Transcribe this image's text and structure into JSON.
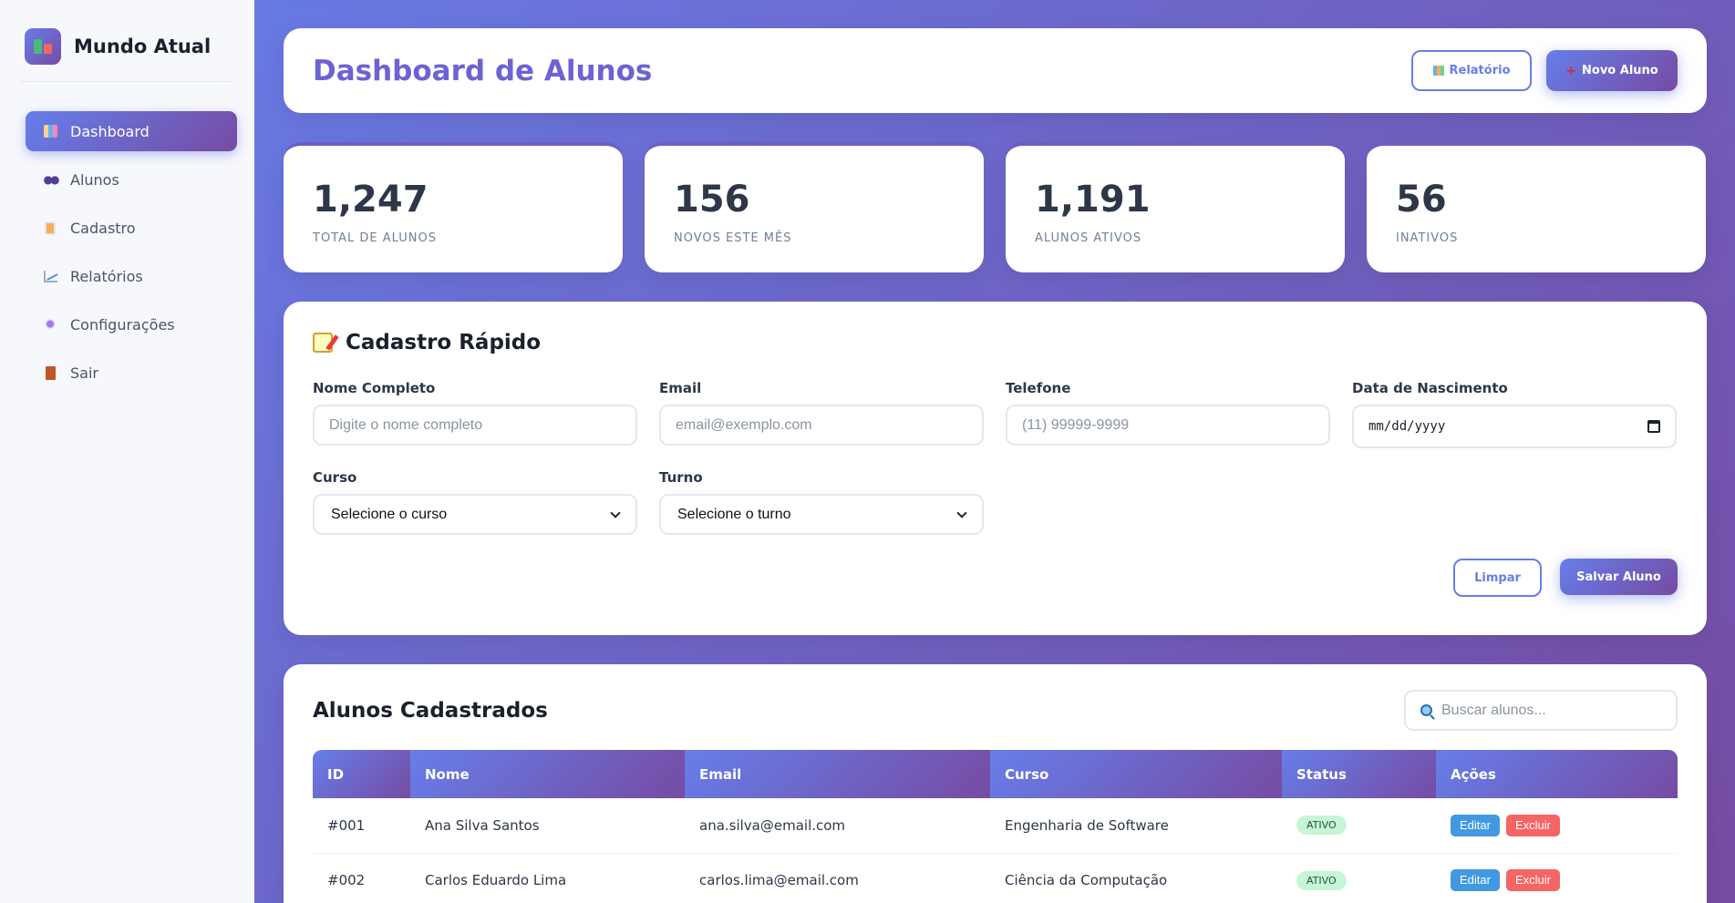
{
  "brand": {
    "name": "Mundo Atual"
  },
  "sidebar": {
    "items": [
      {
        "label": "Dashboard",
        "icon": "dashboard-icon",
        "active": true
      },
      {
        "label": "Alunos",
        "icon": "users-icon"
      },
      {
        "label": "Cadastro",
        "icon": "clipboard-icon"
      },
      {
        "label": "Relatórios",
        "icon": "chart-icon"
      },
      {
        "label": "Configurações",
        "icon": "gear-icon"
      },
      {
        "label": "Sair",
        "icon": "door-icon"
      }
    ]
  },
  "header": {
    "title": "Dashboard de Alunos",
    "report_label": "Relatório",
    "new_label": "Novo Aluno"
  },
  "stats": [
    {
      "value": "1,247",
      "label": "TOTAL DE ALUNOS"
    },
    {
      "value": "156",
      "label": "NOVOS ESTE MÊS"
    },
    {
      "value": "1,191",
      "label": "ALUNOS ATIVOS"
    },
    {
      "value": "56",
      "label": "INATIVOS"
    }
  ],
  "form": {
    "title": "Cadastro Rápido",
    "name_label": "Nome Completo",
    "name_placeholder": "Digite o nome completo",
    "email_label": "Email",
    "email_placeholder": "email@exemplo.com",
    "phone_label": "Telefone",
    "phone_placeholder": "(11) 99999-9999",
    "birth_label": "Data de Nascimento",
    "birth_value": "mm/dd/yyyy",
    "course_label": "Curso",
    "course_value": "Selecione o curso",
    "shift_label": "Turno",
    "shift_value": "Selecione o turno",
    "clear_label": "Limpar",
    "save_label": "Salvar Aluno"
  },
  "table": {
    "title": "Alunos Cadastrados",
    "search_placeholder": "Buscar alunos...",
    "columns": [
      "ID",
      "Nome",
      "Email",
      "Curso",
      "Status",
      "Ações"
    ],
    "rows": [
      {
        "id": "#001",
        "name": "Ana Silva Santos",
        "email": "ana.silva@email.com",
        "course": "Engenharia de Software",
        "status": "ATIVO",
        "edit": "Editar",
        "delete": "Excluir"
      },
      {
        "id": "#002",
        "name": "Carlos Eduardo Lima",
        "email": "carlos.lima@email.com",
        "course": "Ciência da Computação",
        "status": "ATIVO",
        "edit": "Editar",
        "delete": "Excluir"
      }
    ]
  },
  "colors": {
    "accent_start": "#667eea",
    "accent_end": "#764ba2",
    "status_active_bg": "#c6f6d5",
    "edit": "#4299e1",
    "delete": "#f56565"
  }
}
